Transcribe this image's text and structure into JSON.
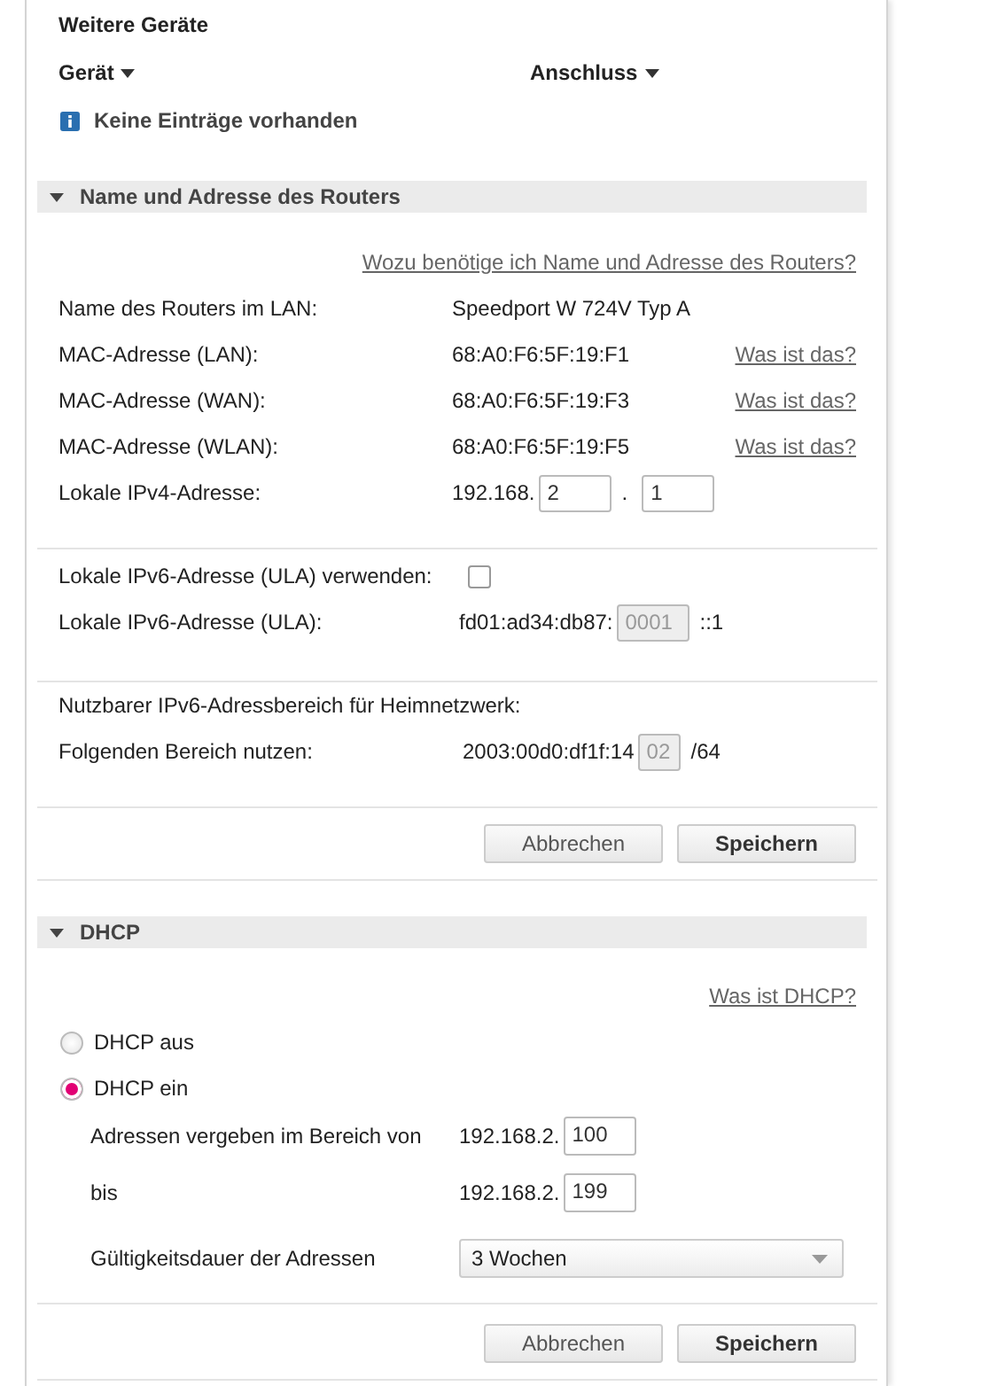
{
  "devices": {
    "title": "Weitere Geräte",
    "columns": [
      "Gerät",
      "Anschluss"
    ],
    "empty_message": "Keine Einträge vorhanden"
  },
  "router_section": {
    "title": "Name und Adresse des Routers",
    "expanded": true,
    "help_link": "Wozu benötige ich Name und Adresse des Routers?",
    "info_rows": [
      {
        "label": "Name des Routers im LAN:",
        "value": "Speedport W 724V Typ A"
      },
      {
        "label": "MAC-Adresse (LAN):",
        "value": "68:A0:F6:5F:19:F1",
        "link": "Was ist das?"
      },
      {
        "label": "MAC-Adresse (WAN):",
        "value": "68:A0:F6:5F:19:F3",
        "link": "Was ist das?"
      },
      {
        "label": "MAC-Adresse (WLAN):",
        "value": "68:A0:F6:5F:19:F5",
        "link": "Was ist das?"
      }
    ],
    "ipv4": {
      "label": "Lokale IPv4-Adresse:",
      "prefix": "192.168.",
      "octet_3": "2",
      "separator": ".",
      "octet_4": "1"
    },
    "ula": {
      "use_label": "Lokale IPv6-Adresse (ULA) verwenden:",
      "checked": false,
      "address_label": "Lokale IPv6-Adresse (ULA):",
      "prefix": "fd01:ad34:db87:",
      "value": "0001",
      "disabled": true,
      "suffix": "::1"
    },
    "range": {
      "heading": "Nutzbarer IPv6-Adressbereich für Heimnetzwerk:",
      "label": "Folgenden Bereich nutzen:",
      "prefix": "2003:00d0:df1f:14",
      "value": "02",
      "disabled": true,
      "suffix": "/64"
    },
    "buttons": [
      {
        "label": "Abbrechen",
        "kind": "secondary"
      },
      {
        "label": "Speichern",
        "kind": "primary"
      }
    ]
  },
  "dhcp_section": {
    "title": "DHCP",
    "expanded": true,
    "help_link": "Was ist DHCP?",
    "options": [
      {
        "label": "DHCP aus",
        "selected": false
      },
      {
        "label": "DHCP ein",
        "selected": true
      }
    ],
    "range_rows": [
      {
        "label": "Adressen vergeben im Bereich von",
        "prefix": "192.168.2.",
        "value": "100"
      },
      {
        "label": "bis",
        "prefix": "192.168.2.",
        "value": "199"
      }
    ],
    "lease": {
      "label": "Gültigkeitsdauer der Adressen",
      "value": "3 Wochen"
    },
    "buttons": [
      {
        "label": "Abbrechen",
        "kind": "secondary"
      },
      {
        "label": "Speichern",
        "kind": "primary"
      }
    ]
  }
}
